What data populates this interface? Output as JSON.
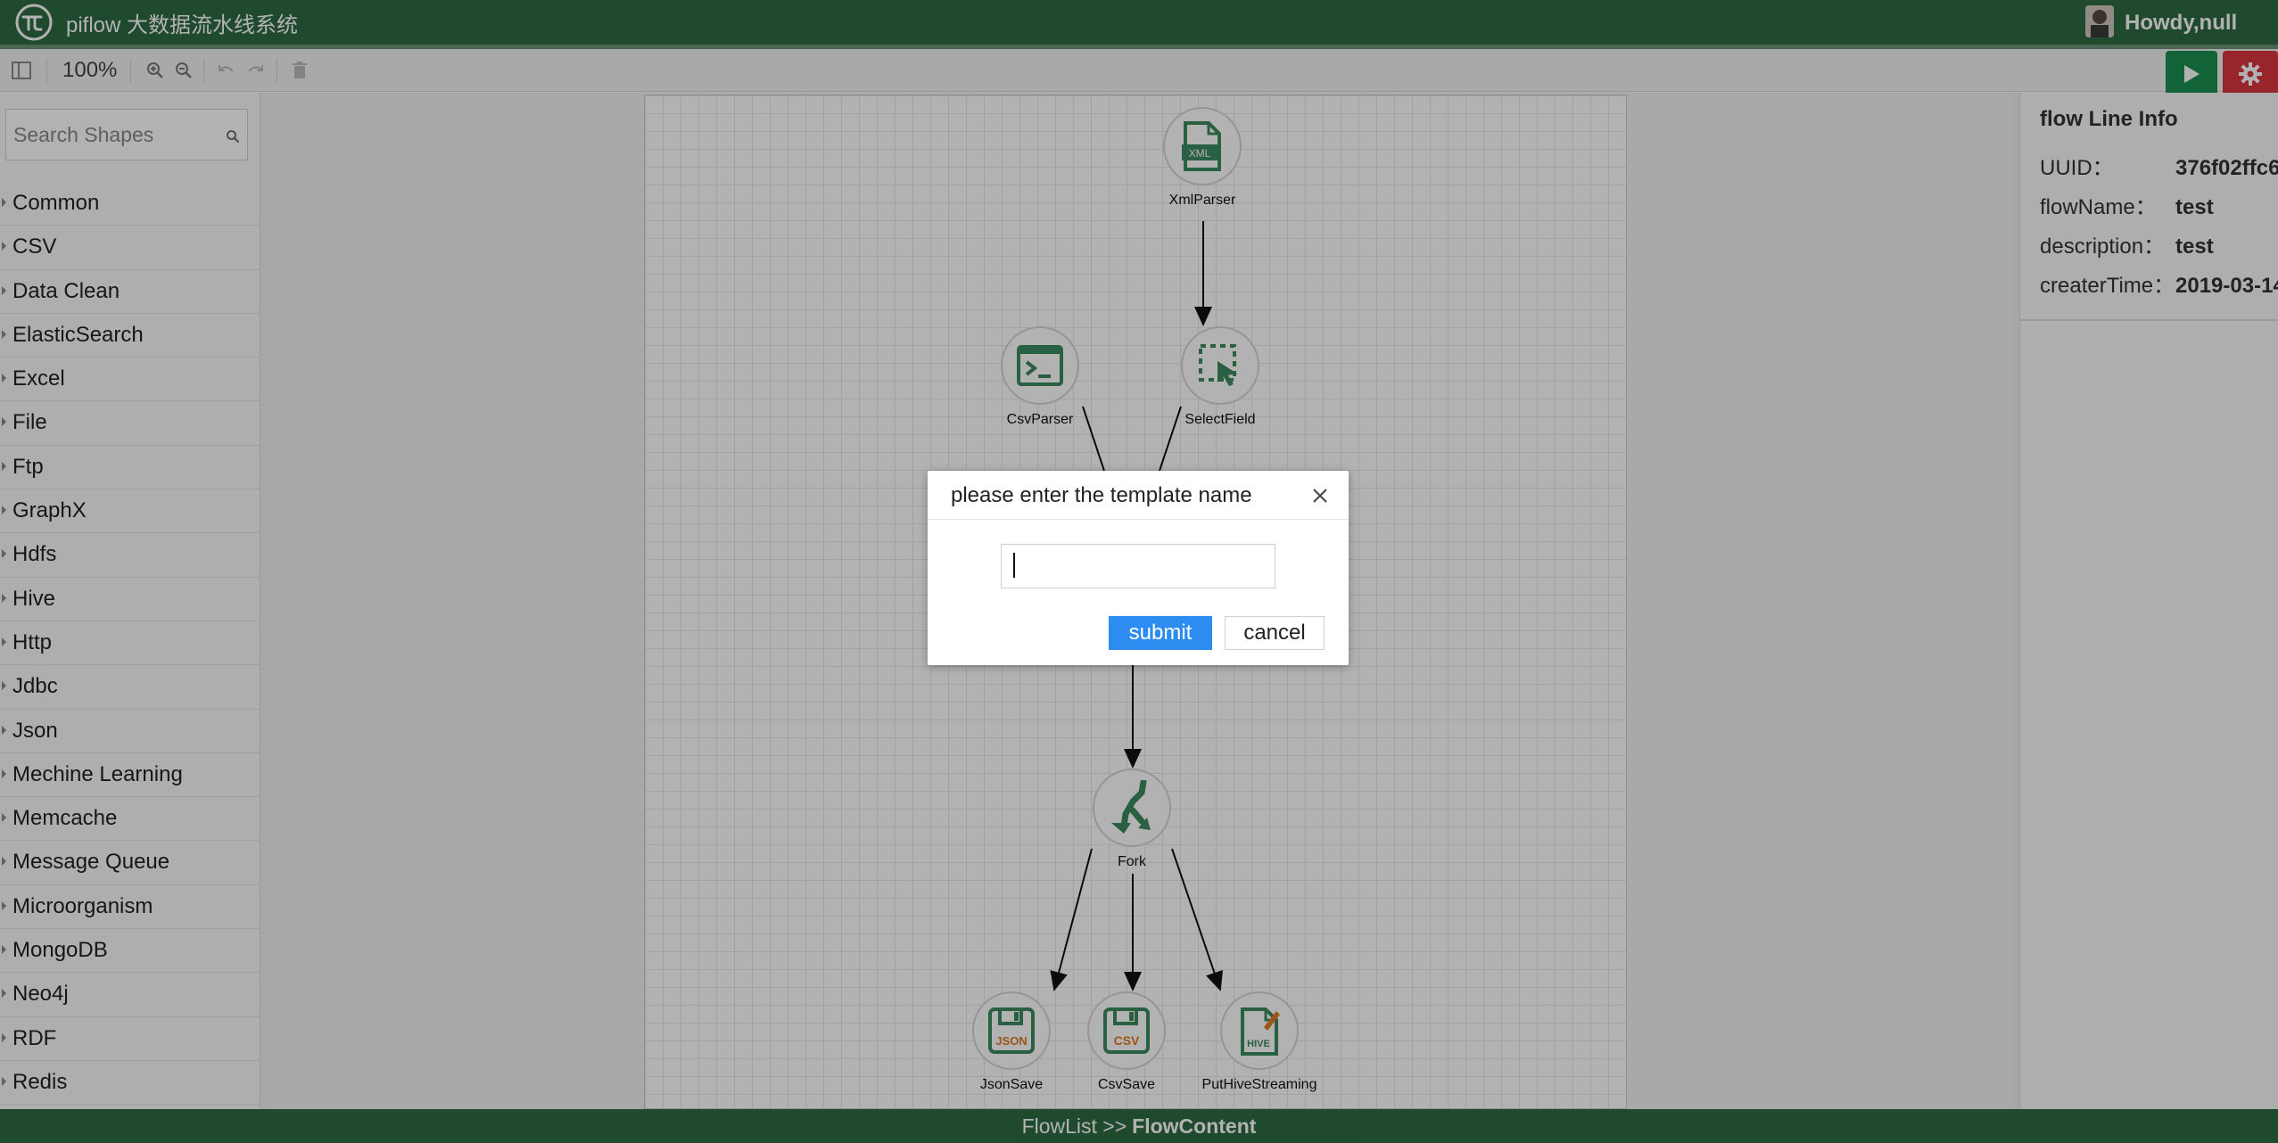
{
  "header": {
    "app_title": "piflow 大数据流水线系统",
    "greeting": "Howdy,null",
    "brand_color": "#2e6b43"
  },
  "toolbar": {
    "zoom_level": "100%",
    "icons": [
      "format-panel-icon",
      "zoom-in-icon",
      "zoom-out-icon",
      "undo-icon",
      "redo-icon",
      "delete-icon",
      "run-icon",
      "gear-icon"
    ]
  },
  "sidebar": {
    "search_placeholder": "Search Shapes",
    "categories": [
      "Common",
      "CSV",
      "Data Clean",
      "ElasticSearch",
      "Excel",
      "File",
      "Ftp",
      "GraphX",
      "Hdfs",
      "Hive",
      "Http",
      "Jdbc",
      "Json",
      "Mechine Learning",
      "Memcache",
      "Message Queue",
      "Microorganism",
      "MongoDB",
      "Neo4j",
      "RDF",
      "Redis"
    ]
  },
  "canvas": {
    "nodes": [
      {
        "label": "XmlParser",
        "icon": "xml-file-icon"
      },
      {
        "label": "CsvParser",
        "icon": "terminal-icon"
      },
      {
        "label": "SelectField",
        "icon": "select-cursor-icon"
      },
      {
        "label": "Fork",
        "icon": "fork-icon"
      },
      {
        "label": "JsonSave",
        "icon": "json-save-icon"
      },
      {
        "label": "CsvSave",
        "icon": "csv-save-icon"
      },
      {
        "label": "PutHiveStreaming",
        "icon": "hive-icon"
      }
    ],
    "icon_texts": {
      "xml": "XML",
      "json": "JSON",
      "csv": "CSV",
      "hive": "HIVE"
    },
    "node_icon_color": "#3d8a5f"
  },
  "info_panel": {
    "title": "flow Line Info",
    "rows": [
      {
        "key": "UUID：",
        "value": "376f02ffc6"
      },
      {
        "key": "flowName：",
        "value": "test"
      },
      {
        "key": "description：",
        "value": "test"
      },
      {
        "key": "createrTime：",
        "value": "2019-03-14"
      }
    ]
  },
  "modal": {
    "title": "please enter the template name",
    "input_value": "",
    "submit_label": "submit",
    "cancel_label": "cancel",
    "submit_color": "#2d8cf0"
  },
  "footer": {
    "crumb": "FlowList >>",
    "current": "FlowContent"
  }
}
